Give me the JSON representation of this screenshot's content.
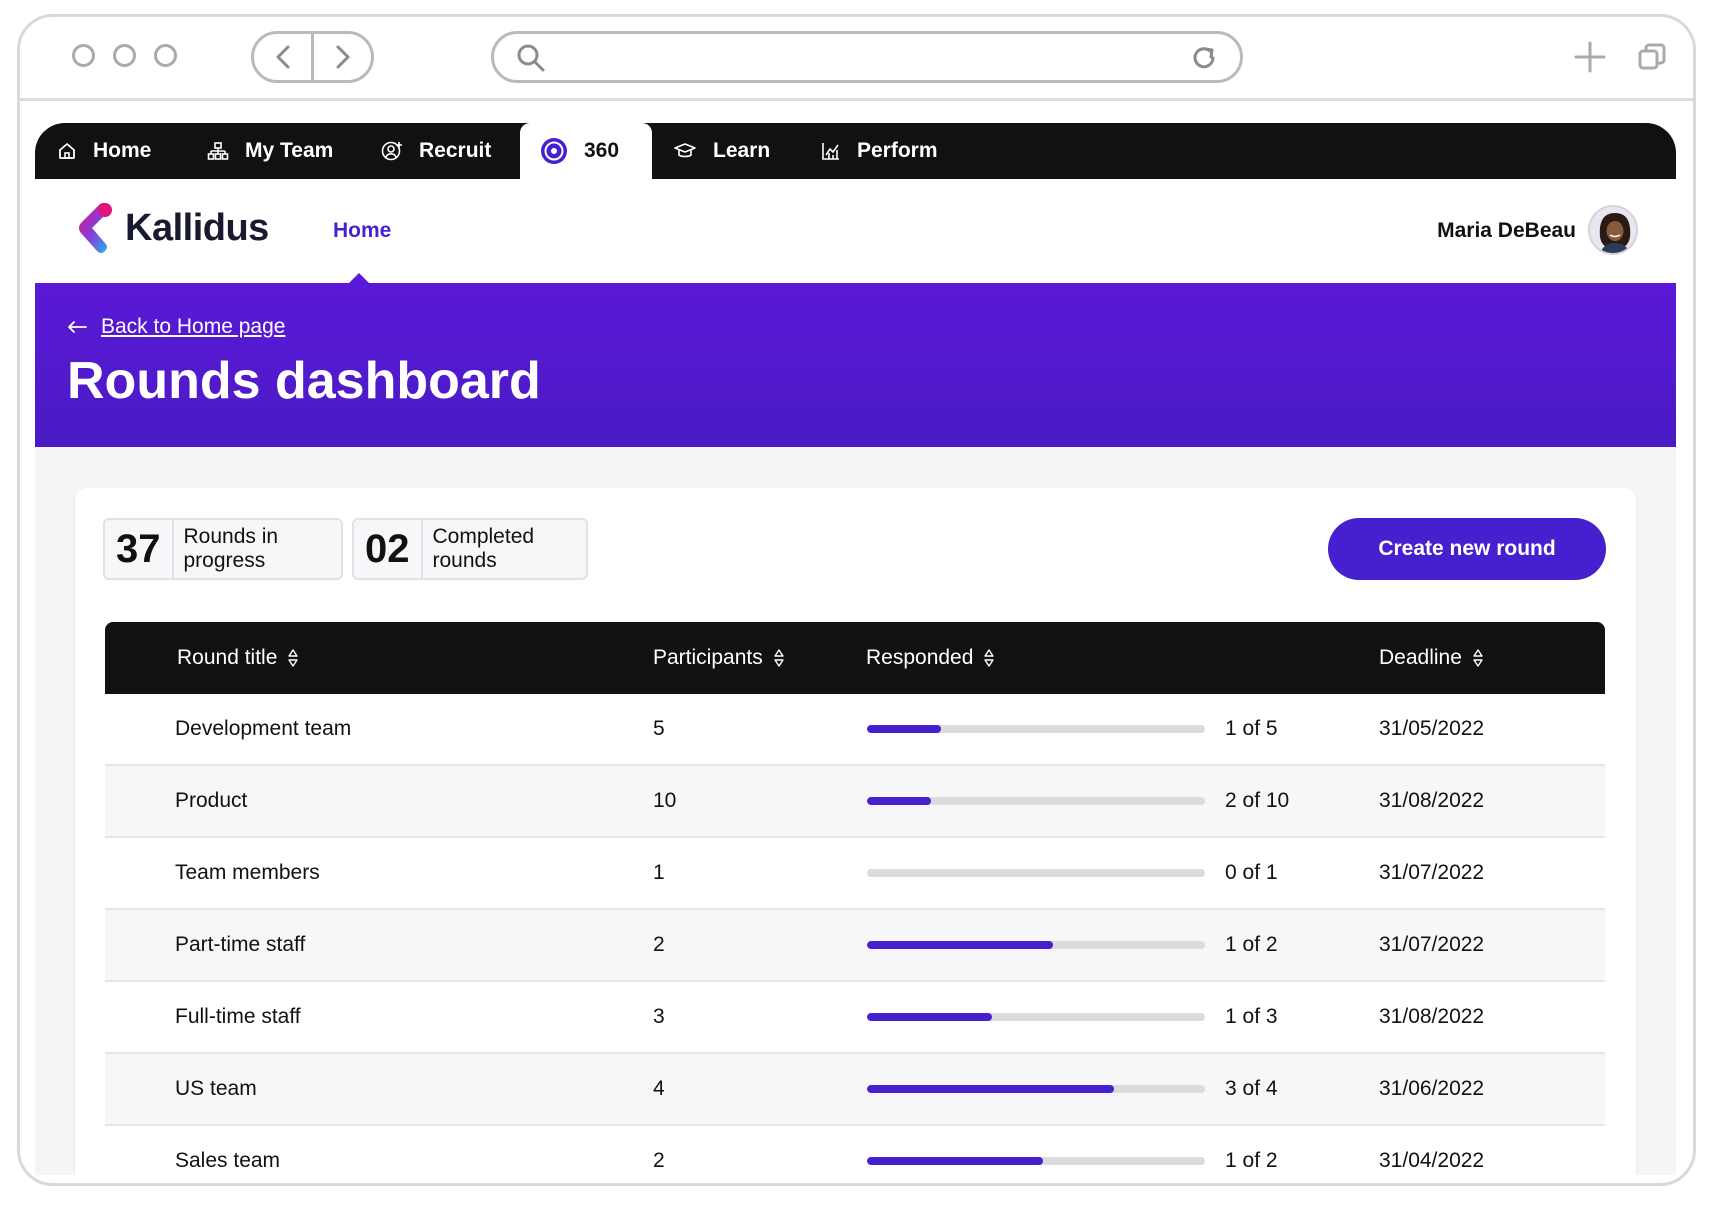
{
  "browser": {
    "icons": [
      "circle-icon",
      "back-arrow-icon",
      "forward-arrow-icon",
      "search-icon",
      "reload-icon",
      "plus-icon",
      "tabs-icon"
    ]
  },
  "topnav": {
    "items": [
      {
        "label": "Home",
        "icon": "home-icon"
      },
      {
        "label": "My Team",
        "icon": "team-icon"
      },
      {
        "label": "Recruit",
        "icon": "recruit-icon"
      },
      {
        "label": "360",
        "icon": "target-icon",
        "active": true
      },
      {
        "label": "Learn",
        "icon": "graduation-cap-icon"
      },
      {
        "label": "Perform",
        "icon": "chart-icon"
      }
    ]
  },
  "header": {
    "logo_text": "Kallidus",
    "nav_home": "Home",
    "user_name": "Maria DeBeau"
  },
  "hero": {
    "back_link": "Back to Home page",
    "title": "Rounds dashboard"
  },
  "stats": [
    {
      "value": "37",
      "label": "Rounds in progress"
    },
    {
      "value": "02",
      "label": "Completed rounds"
    }
  ],
  "actions": {
    "create_label": "Create new round"
  },
  "table": {
    "columns": [
      "Round title",
      "Participants",
      "Responded",
      "Deadline"
    ],
    "rows": [
      {
        "title": "Development team",
        "participants": "5",
        "responded": "1 of 5",
        "progress": 0.22,
        "deadline": "31/05/2022"
      },
      {
        "title": "Product",
        "participants": "10",
        "responded": "2 of 10",
        "progress": 0.19,
        "deadline": "31/08/2022"
      },
      {
        "title": "Team members",
        "participants": "1",
        "responded": "0 of 1",
        "progress": 0,
        "deadline": "31/07/2022"
      },
      {
        "title": "Part-time staff",
        "participants": "2",
        "responded": "1 of 2",
        "progress": 0.55,
        "deadline": "31/07/2022"
      },
      {
        "title": "Full-time staff",
        "participants": "3",
        "responded": "1 of 3",
        "progress": 0.37,
        "deadline": "31/08/2022"
      },
      {
        "title": "US team",
        "participants": "4",
        "responded": "3 of 4",
        "progress": 0.73,
        "deadline": "31/06/2022"
      },
      {
        "title": "Sales team",
        "participants": "2",
        "responded": "1 of 2",
        "progress": 0.52,
        "deadline": "31/04/2022"
      }
    ]
  },
  "colors": {
    "accent": "#4620cf",
    "hero": "#5b18d8",
    "nav": "#111111"
  }
}
